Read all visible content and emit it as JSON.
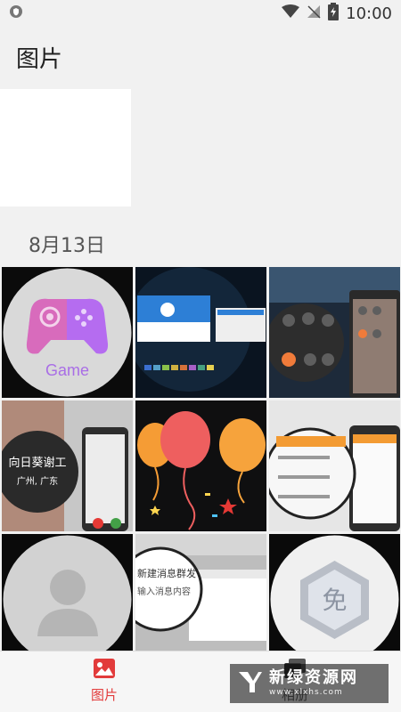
{
  "status_bar": {
    "time": "10:00",
    "icons": [
      "shield-icon",
      "wifi-icon",
      "no-signal-icon",
      "battery-charging-icon"
    ]
  },
  "header": {
    "title": "图片"
  },
  "section": {
    "date": "8月13日"
  },
  "photos": [
    {
      "label": "Game"
    },
    {
      "label": ""
    },
    {
      "label": ""
    },
    {
      "label": "向日葵谢工",
      "sublabel": "广州, 广东"
    },
    {
      "label": ""
    },
    {
      "label": ""
    },
    {
      "label": ""
    },
    {
      "label": "新建消息群发",
      "sublabel": "输入消息内容"
    },
    {
      "label": "免"
    }
  ],
  "bottom_nav": {
    "items": [
      {
        "label": "图片",
        "icon": "photo-icon",
        "active": true
      },
      {
        "label": "相册",
        "icon": "album-icon",
        "active": false
      }
    ]
  },
  "watermark": {
    "title": "新绿资源网",
    "subtitle": "www.xlxhs.com"
  },
  "colors": {
    "accent": "#e23b3b",
    "background": "#f1f1f1"
  }
}
